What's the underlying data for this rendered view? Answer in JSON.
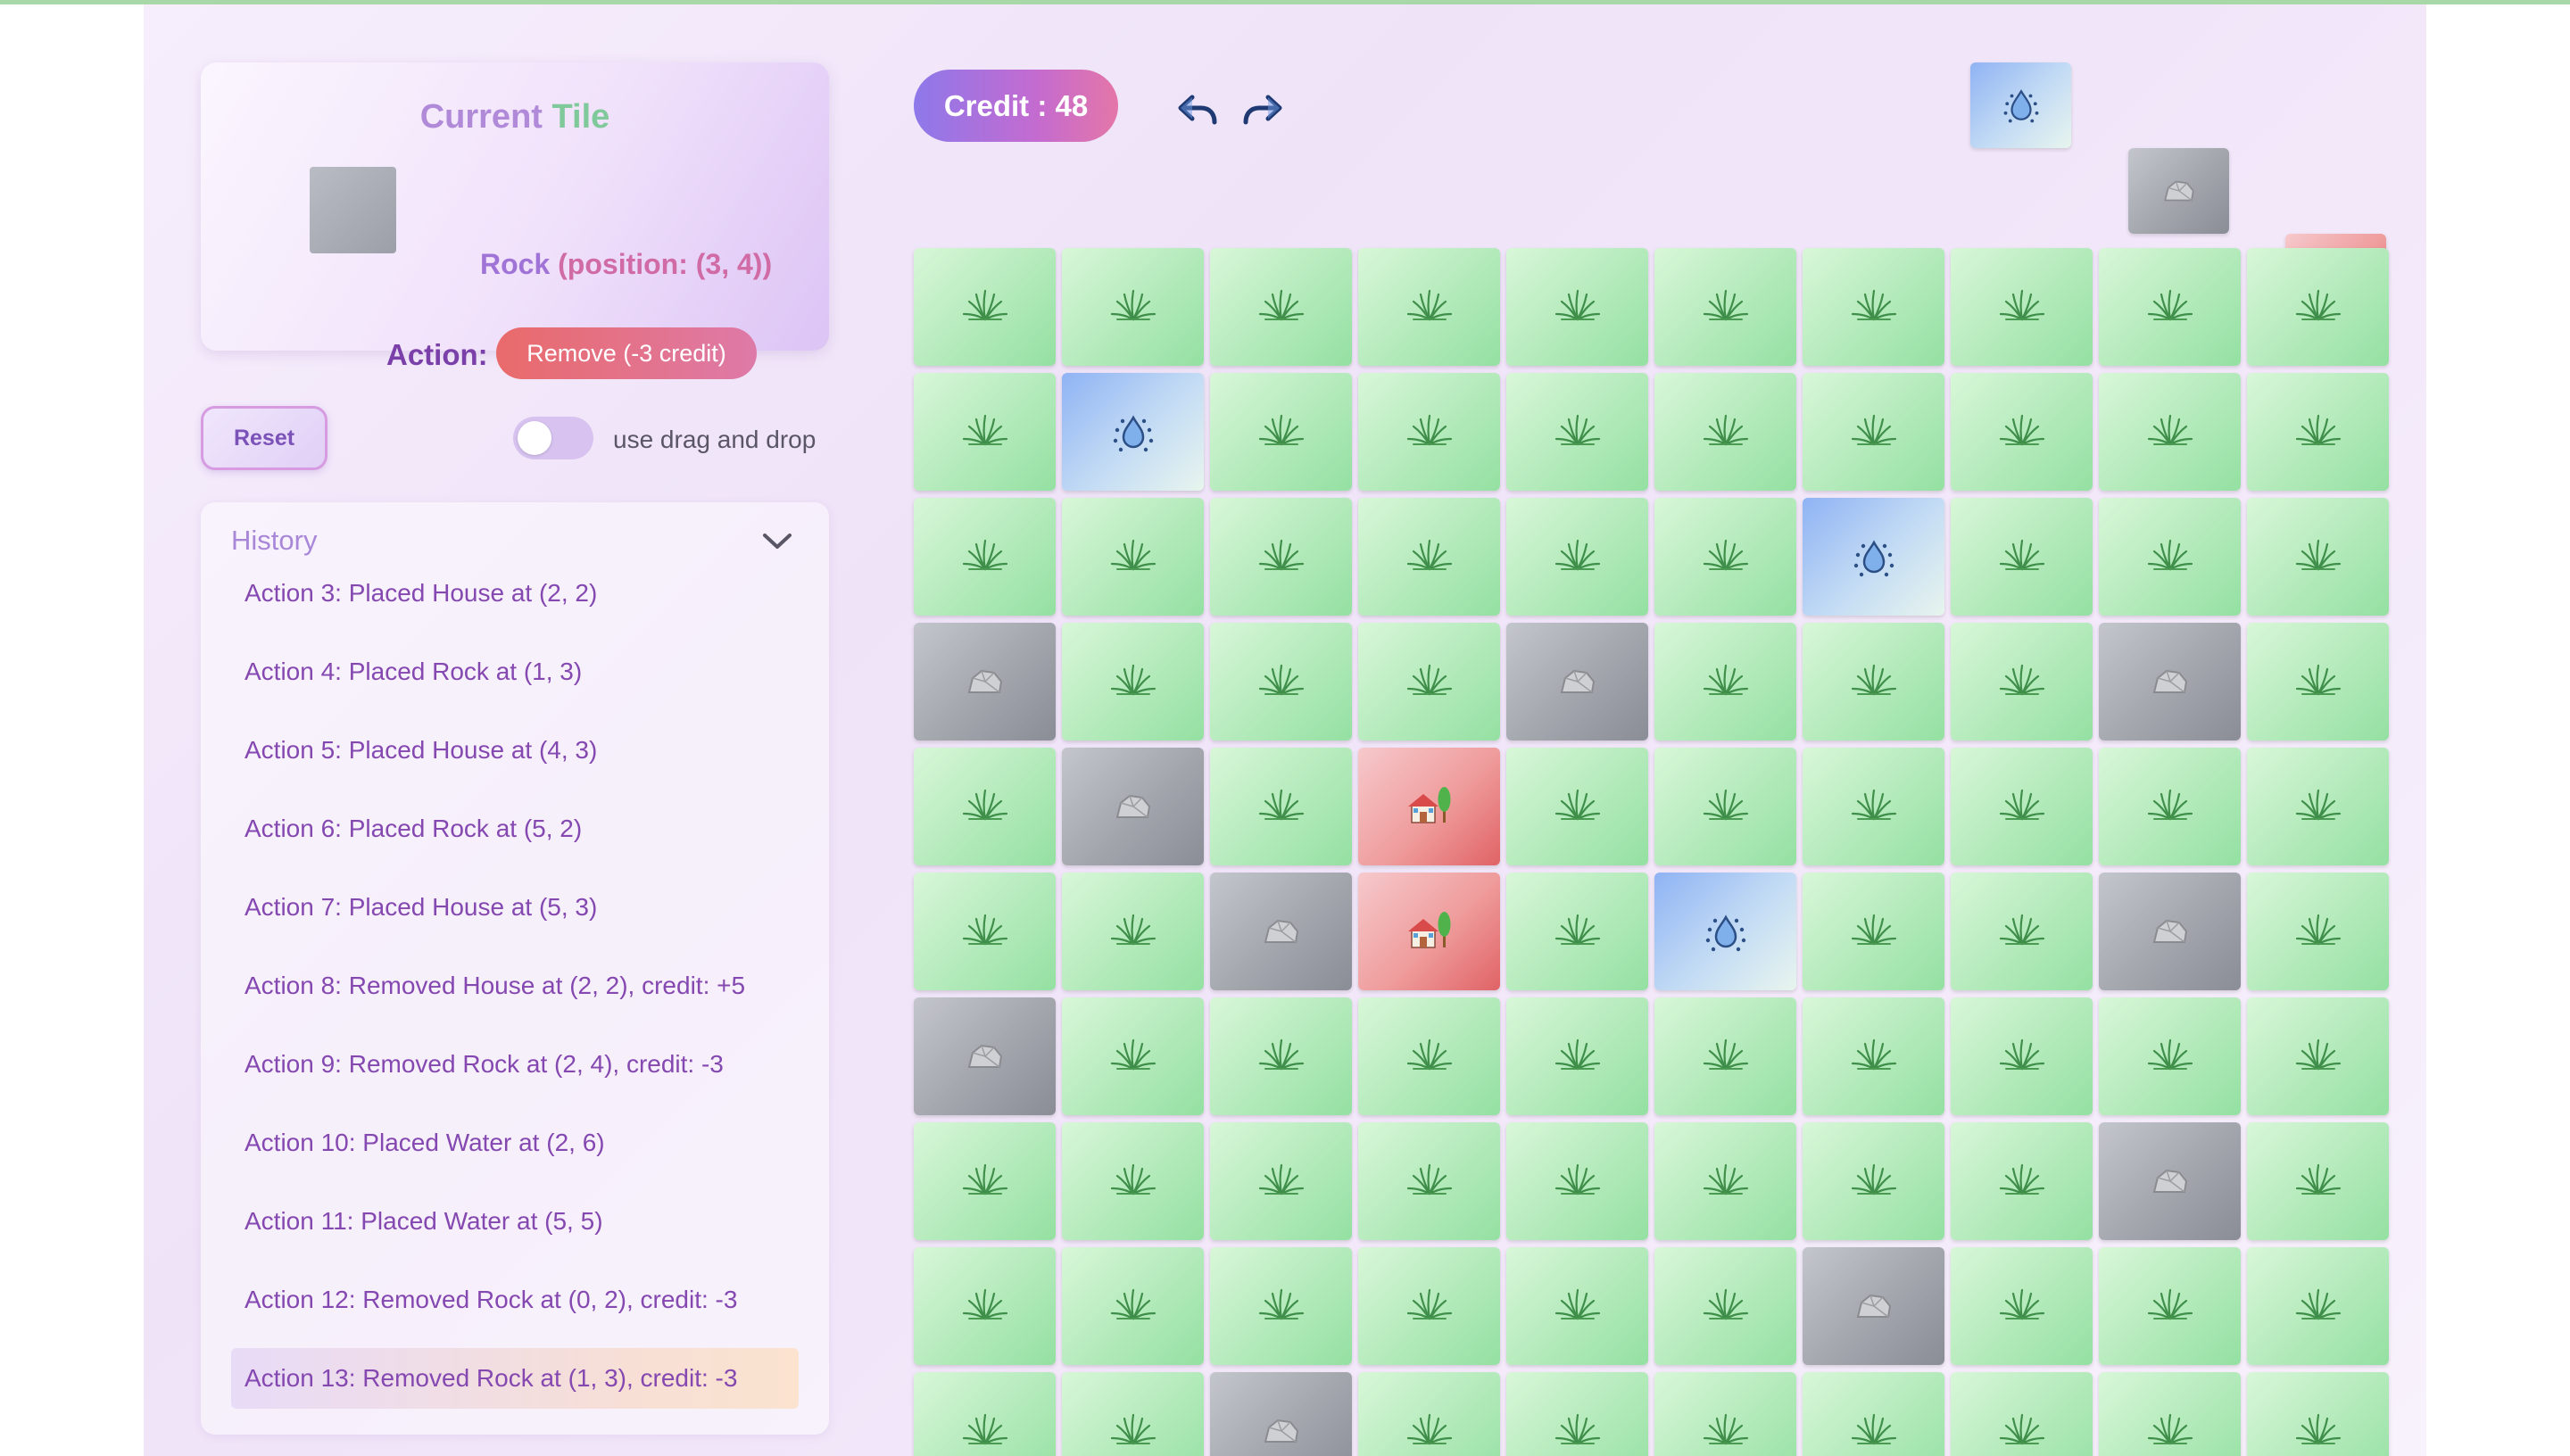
{
  "current_tile": {
    "title_part1": "Current",
    "title_part2": "Tile",
    "name": "Rock",
    "position_text": "(position: (3, 4))",
    "action_label": "Action:",
    "action_button": "Remove (-3 credit)"
  },
  "controls": {
    "reset_label": "Reset",
    "toggle_label": "use drag and drop",
    "toggle_on": false
  },
  "history": {
    "title": "History",
    "items": [
      "Action 3: Placed House at (2, 2)",
      "Action 4: Placed Rock at (1, 3)",
      "Action 5: Placed House at (4, 3)",
      "Action 6: Placed Rock at (5, 2)",
      "Action 7: Placed House at (5, 3)",
      "Action 8: Removed House at (2, 2), credit: +5",
      "Action 9: Removed Rock at (2, 4), credit: -3",
      "Action 10: Placed Water at (2, 6)",
      "Action 11: Placed Water at (5, 5)",
      "Action 12: Removed Rock at (0, 2), credit: -3",
      "Action 13: Removed Rock at (1, 3), credit: -3"
    ],
    "active_index": 10
  },
  "credit_label": "Credit : 48",
  "palette": [
    "water",
    "rock",
    "house"
  ],
  "grid": [
    [
      "grass",
      "grass",
      "grass",
      "grass",
      "grass",
      "grass",
      "grass",
      "grass",
      "grass",
      "grass"
    ],
    [
      "grass",
      "water",
      "grass",
      "grass",
      "grass",
      "grass",
      "grass",
      "grass",
      "grass",
      "grass"
    ],
    [
      "grass",
      "grass",
      "grass",
      "grass",
      "grass",
      "grass",
      "water",
      "grass",
      "grass",
      "grass"
    ],
    [
      "rock",
      "grass",
      "grass",
      "grass",
      "rock",
      "grass",
      "grass",
      "grass",
      "rock",
      "grass"
    ],
    [
      "grass",
      "rock",
      "grass",
      "house",
      "grass",
      "grass",
      "grass",
      "grass",
      "grass",
      "grass"
    ],
    [
      "grass",
      "grass",
      "rock",
      "house",
      "grass",
      "water",
      "grass",
      "grass",
      "rock",
      "grass"
    ],
    [
      "rock",
      "grass",
      "grass",
      "grass",
      "grass",
      "grass",
      "grass",
      "grass",
      "grass",
      "grass"
    ],
    [
      "grass",
      "grass",
      "grass",
      "grass",
      "grass",
      "grass",
      "grass",
      "grass",
      "rock",
      "grass"
    ],
    [
      "grass",
      "grass",
      "grass",
      "grass",
      "grass",
      "grass",
      "rock",
      "grass",
      "grass",
      "grass"
    ],
    [
      "grass",
      "grass",
      "rock",
      "grass",
      "grass",
      "grass",
      "grass",
      "grass",
      "grass",
      "grass"
    ]
  ],
  "colors": {
    "grass": "#b6ebbd",
    "water": "#a9c8f4",
    "rock": "#a3a5ad",
    "house": "#ef9c9c",
    "accent": "#a073d6"
  }
}
